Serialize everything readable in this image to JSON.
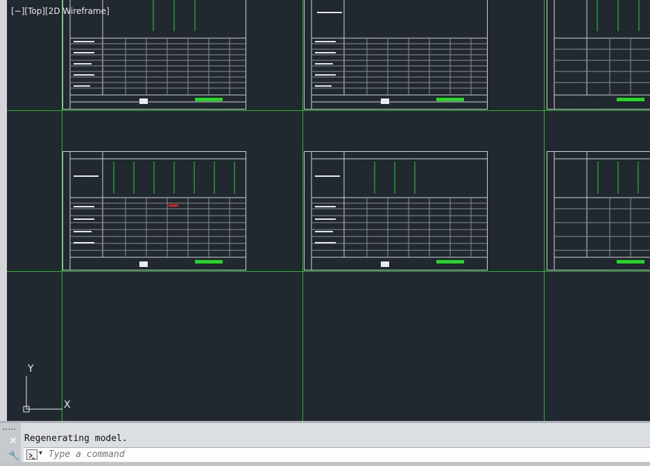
{
  "viewport": {
    "label": "[−][Top][2D Wireframe]",
    "background": "#212830",
    "grid_color": "#1fbf1f"
  },
  "ucs": {
    "y_label": "Y",
    "x_label": "X"
  },
  "command": {
    "history": "Regenerating model.",
    "placeholder": "Type a command"
  },
  "icons": {
    "close": "close-icon",
    "customize": "wrench-icon",
    "command": "command-prompt-icon",
    "dropdown": "chevron-down-icon"
  }
}
